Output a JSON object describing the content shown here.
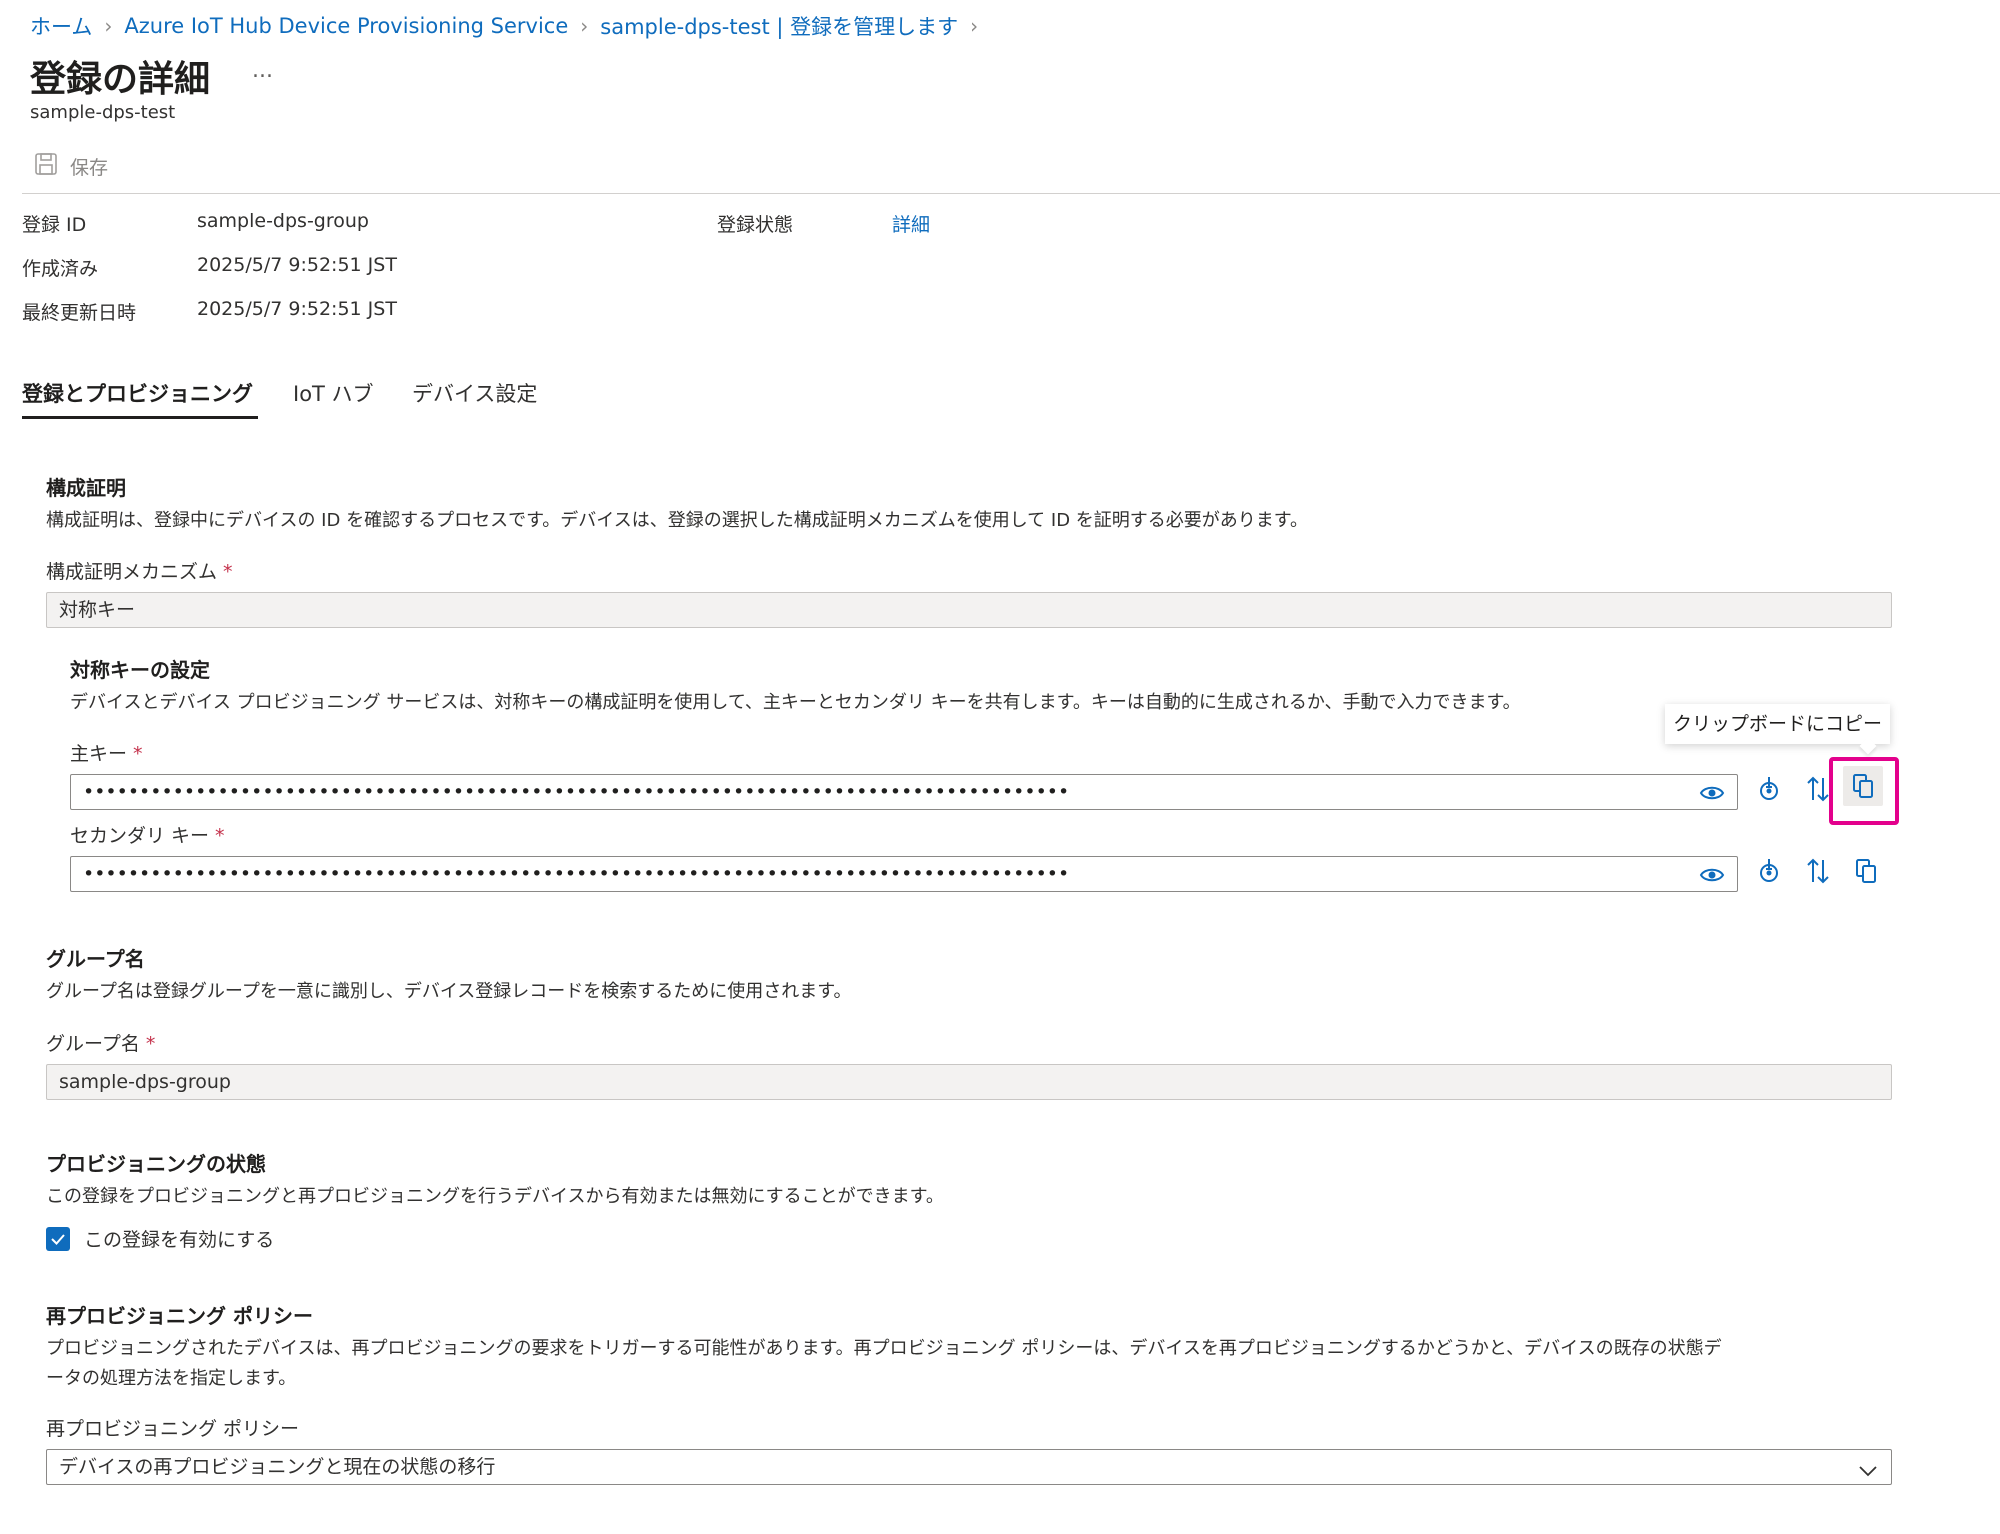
{
  "breadcrumb": {
    "items": [
      "ホーム",
      "Azure IoT Hub Device Provisioning Service",
      "sample-dps-test | 登録を管理します"
    ]
  },
  "header": {
    "title": "登録の詳細",
    "more": "...",
    "subtitle": "sample-dps-test"
  },
  "toolbar": {
    "save_label": "保存"
  },
  "info": {
    "registration_id_label": "登録 ID",
    "registration_id_value": "sample-dps-group",
    "created_label": "作成済み",
    "created_value": "2025/5/7 9:52:51 JST",
    "updated_label": "最終更新日時",
    "updated_value": "2025/5/7 9:52:51 JST",
    "status_label": "登録状態",
    "status_link": "詳細"
  },
  "tabs": [
    "登録とプロビジョニング",
    "IoT ハブ",
    "デバイス設定"
  ],
  "attestation": {
    "title": "構成証明",
    "description": "構成証明は、登録中にデバイスの ID を確認するプロセスです。デバイスは、登録の選択した構成証明メカニズムを使用して ID を証明する必要があります。",
    "mechanism_label": "構成証明メカニズム",
    "mechanism_value": "対称キー"
  },
  "symmetric_key": {
    "title": "対称キーの設定",
    "description": "デバイスとデバイス プロビジョニング サービスは、対称キーの構成証明を使用して、主キーとセカンダリ キーを共有します。キーは自動的に生成されるか、手動で入力できます。",
    "primary_label": "主キー",
    "primary_value": "••••••••••••••••••••••••••••••••••••••••••••••••••••••••••••••••••••••••••••••••••••••••",
    "secondary_label": "セカンダリ キー",
    "secondary_value": "••••••••••••••••••••••••••••••••••••••••••••••••••••••••••••••••••••••••••••••••••••••••",
    "tooltip": "クリップボードにコピー"
  },
  "group": {
    "title": "グループ名",
    "description": "グループ名は登録グループを一意に識別し、デバイス登録レコードを検索するために使用されます。",
    "label": "グループ名",
    "value": "sample-dps-group"
  },
  "provisioning": {
    "title": "プロビジョニングの状態",
    "description": "この登録をプロビジョニングと再プロビジョニングを行うデバイスから有効または無効にすることができます。",
    "checkbox_label": "この登録を有効にする",
    "checkbox_checked": true
  },
  "reprovision": {
    "title": "再プロビジョニング ポリシー",
    "description_line1": "プロビジョニングされたデバイスは、再プロビジョニングの要求をトリガーする可能性があります。再プロビジョニング ポリシーは、デバイスを再プロビジョニングするかどうかと、デバイスの既存の状態デ",
    "description_line2": "ータの処理方法を指定します。",
    "label": "再プロビジョニング ポリシー",
    "selected": "デバイスの再プロビジョニングと現在の状態の移行"
  },
  "colors": {
    "accent": "#0f6cbd",
    "highlight": "#e3008c",
    "required": "#c4314b"
  }
}
